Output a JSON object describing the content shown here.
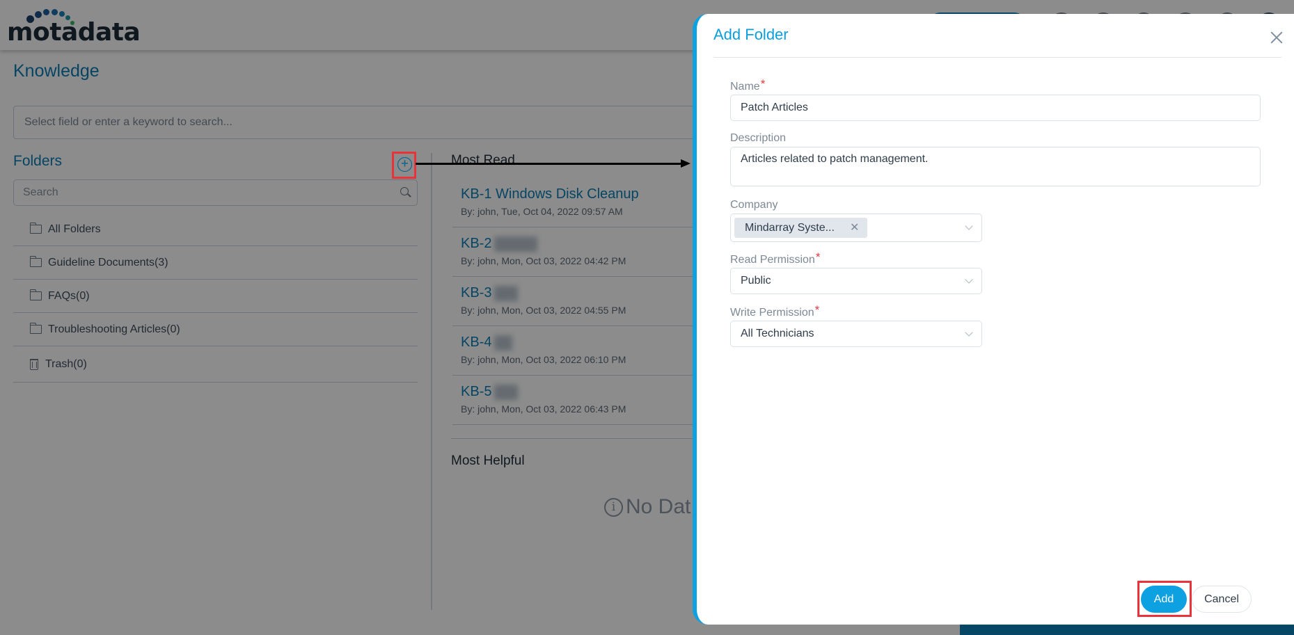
{
  "header": {
    "logo_text": "motadata"
  },
  "page": {
    "title": "Knowledge",
    "search_placeholder": "Select field or enter a keyword to search..."
  },
  "folders": {
    "title": "Folders",
    "add_icon": "plus-circle-icon",
    "search_placeholder": "Search",
    "items": [
      {
        "label": "All Folders",
        "icon": "folder-icon"
      },
      {
        "label": "Guideline Documents(3)",
        "icon": "folder-icon"
      },
      {
        "label": "FAQs(0)",
        "icon": "folder-icon"
      },
      {
        "label": "Troubleshooting Articles(0)",
        "icon": "folder-icon"
      },
      {
        "label": "Trash(0)",
        "icon": "trash-icon"
      }
    ]
  },
  "most_read": {
    "title": "Most Read",
    "articles": [
      {
        "title": "KB-1 Windows Disk Cleanup",
        "meta": "By: john, Tue, Oct 04, 2022 09:57 AM"
      },
      {
        "title": "KB-2",
        "meta": "By: john, Mon, Oct 03, 2022 04:42 PM"
      },
      {
        "title": "KB-3",
        "meta": "By: john, Mon, Oct 03, 2022 04:55 PM"
      },
      {
        "title": "KB-4",
        "meta": "By: john, Mon, Oct 03, 2022 06:10 PM"
      },
      {
        "title": "KB-5",
        "meta": "By: john, Mon, Oct 03, 2022 06:43 PM"
      }
    ]
  },
  "most_helpful": {
    "title": "Most Helpful",
    "empty_text": "No Dat"
  },
  "dialog": {
    "title": "Add Folder",
    "fields": {
      "name": {
        "label": "Name",
        "required": "*",
        "value": "Patch Articles"
      },
      "description": {
        "label": "Description",
        "value": "Articles related to patch management."
      },
      "company": {
        "label": "Company",
        "tag": "Mindarray Syste..."
      },
      "read_permission": {
        "label": "Read Permission",
        "required": "*",
        "value": "Public"
      },
      "write_permission": {
        "label": "Write Permission",
        "required": "*",
        "value": "All Technicians"
      }
    },
    "buttons": {
      "add": "Add",
      "cancel": "Cancel"
    }
  },
  "colors": {
    "accent": "#0ea1e2",
    "link": "#0a7fb5",
    "required": "#e0383e",
    "annotation": "#e8333b"
  }
}
